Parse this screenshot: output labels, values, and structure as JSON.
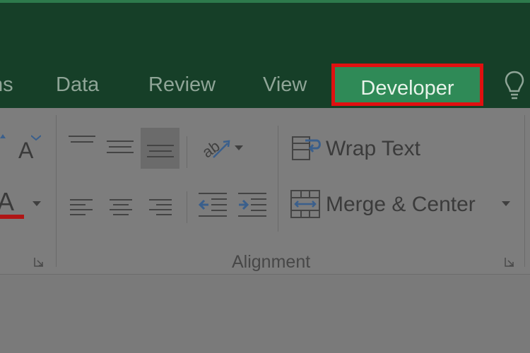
{
  "tabs": [
    {
      "label": "ns"
    },
    {
      "label": "Data"
    },
    {
      "label": "Review"
    },
    {
      "label": "View"
    },
    {
      "label": "Developer",
      "active": true
    }
  ],
  "ribbon": {
    "alignment_group": {
      "label": "Alignment",
      "wrap_text": "Wrap Text",
      "merge_center": "Merge & Center"
    },
    "font_group": {
      "font_color_letter": "A",
      "font_size_letter": "A"
    }
  },
  "colors": {
    "title_green": "#163f28",
    "active_tab": "#2f8a57",
    "highlight_box": "#e01010",
    "ribbon_gray": "#7d7d7d"
  },
  "icons": [
    "lightbulb-icon",
    "align-top-icon",
    "align-middle-icon",
    "align-bottom-icon",
    "orientation-icon",
    "align-left-icon",
    "align-center-icon",
    "align-right-icon",
    "decrease-indent-icon",
    "increase-indent-icon",
    "wrap-text-icon",
    "merge-center-icon",
    "dropdown-arrow-icon",
    "dialog-launcher-icon"
  ]
}
